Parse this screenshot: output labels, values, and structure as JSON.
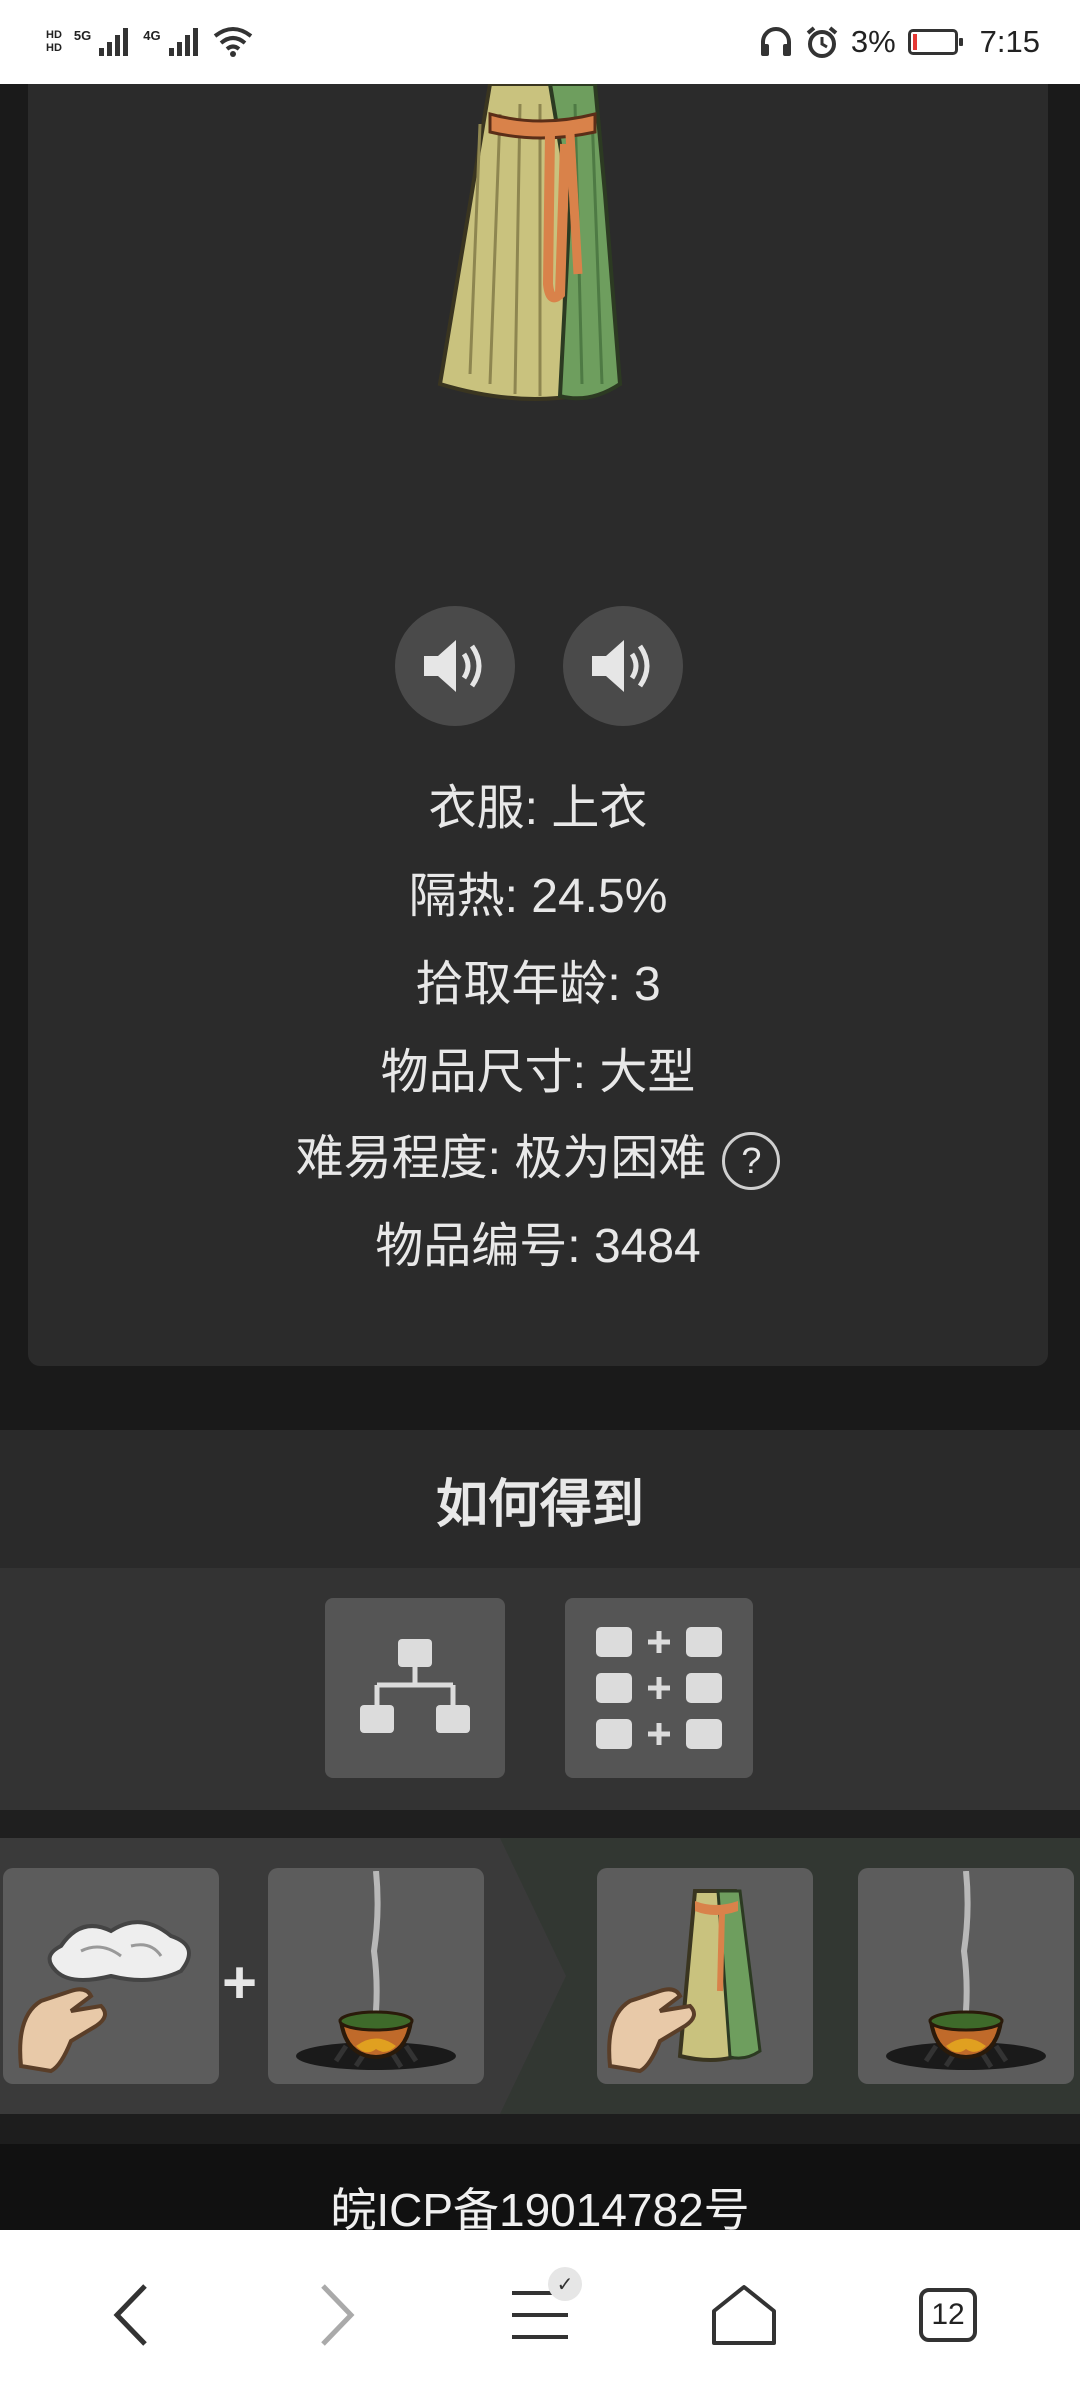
{
  "status_bar": {
    "hd1": "HD",
    "hd2": "HD",
    "net1": "5G",
    "net2": "4G",
    "battery": "3%",
    "time": "7:15",
    "icons": [
      "headphones-icon",
      "alarm-icon",
      "battery-icon",
      "wifi-icon",
      "signal-icon"
    ]
  },
  "item": {
    "clothing": "衣服: 上衣",
    "insulation": "隔热: 24.5%",
    "pickup_age": "拾取年龄: 3",
    "size": "物品尺寸: 大型",
    "difficulty": "难易程度: 极为困难",
    "help": "?",
    "id": "物品编号: 3484"
  },
  "how_to_get": {
    "title": "如何得到",
    "recipe": {
      "plus": "+"
    }
  },
  "footer": {
    "icp": "皖ICP备19014782号"
  },
  "browser_nav": {
    "tabs_count": "12",
    "check": "✓"
  },
  "colors": {
    "card_bg": "#2b2b2b",
    "page_bg": "#1a1a1a",
    "robe_green": "#6a9a5a",
    "robe_straw": "#c8c07a",
    "sash": "#d9824a"
  }
}
